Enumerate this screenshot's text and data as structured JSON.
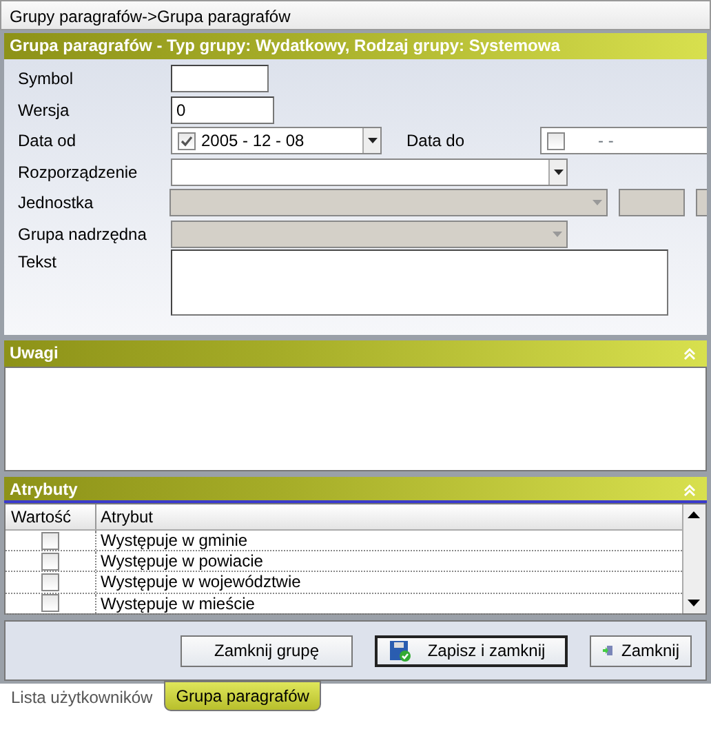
{
  "breadcrumb": "Grupy  paragrafów->Grupa paragrafów",
  "main_panel": {
    "title": "Grupa paragrafów - Typ grupy: Wydatkowy, Rodzaj grupy: Systemowa",
    "fields": [
      {
        "kind": "text",
        "label": "Symbol"
      },
      {
        "kind": "text",
        "label": "Wersja",
        "value": "0"
      },
      {
        "kind": "dates",
        "label": "Data od",
        "value": "2005 - 12 - 08",
        "checked": true,
        "label2": "Data do",
        "value2": "- -",
        "checked2": false
      },
      {
        "kind": "select",
        "label": "Rozporządzenie",
        "disabled": false
      },
      {
        "kind": "unit",
        "label": "Jednostka",
        "disabled": true
      },
      {
        "kind": "select",
        "label": "Grupa nadrzędna",
        "disabled": true
      },
      {
        "kind": "textarea",
        "label": "Tekst"
      }
    ]
  },
  "notes_panel": {
    "title": "Uwagi",
    "expanded": true
  },
  "attributes_panel": {
    "title": "Atrybuty",
    "expanded": true,
    "columns": [
      "Wartość",
      "Atrybut"
    ],
    "rows": [
      {
        "checked": false,
        "name": "Występuje w gminie"
      },
      {
        "checked": false,
        "name": "Występuje w powiacie"
      },
      {
        "checked": false,
        "name": "Występuje w województwie"
      },
      {
        "checked": false,
        "name": "Występuje w mieście"
      }
    ]
  },
  "buttons": [
    {
      "kind": "plain",
      "label": "Zamknij grupę",
      "default": false
    },
    {
      "kind": "save",
      "label": "Zapisz i zamknij",
      "default": true
    },
    {
      "kind": "exit",
      "label": "Zamknij",
      "default": false
    }
  ],
  "tabs": [
    {
      "label": "Lista użytkowników",
      "selected": false
    },
    {
      "label": "Grupa paragrafów",
      "selected": true
    }
  ]
}
